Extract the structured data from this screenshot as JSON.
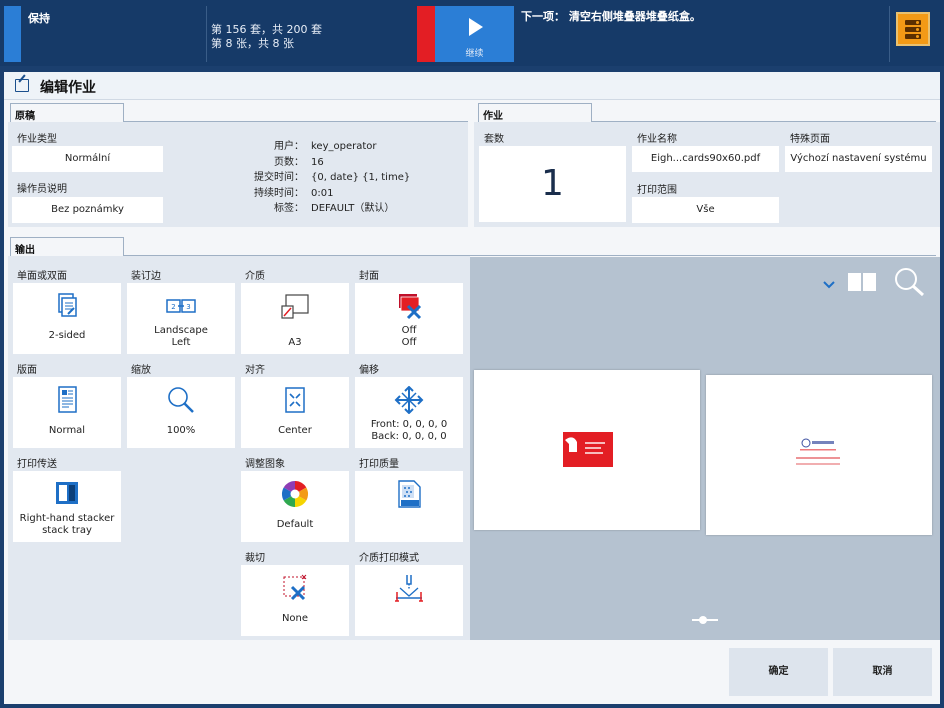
{
  "topbar": {
    "hold_label": "保持",
    "status_sets": "第 156 套，共 200 套",
    "status_sheets": "第 8 张，共 8 张",
    "continue_label": "继续",
    "next_step": "下一项： 清空右侧堆叠器堆叠纸盒。",
    "icons": {
      "continue": "play-icon",
      "menu": "stacker-menu-icon"
    }
  },
  "header": {
    "title": "编辑作业",
    "icon": "edit-job-icon"
  },
  "original": {
    "tab": "原稿",
    "job_type_label": "作业类型",
    "job_type_value": "Normální",
    "operator_note_label": "操作员说明",
    "operator_note_value": "Bez poznámky",
    "meta": [
      {
        "key": "用户：",
        "value": "key_operator"
      },
      {
        "key": "页数：",
        "value": "16"
      },
      {
        "key": "提交时间：",
        "value": "{0, date} {1, time}"
      },
      {
        "key": "持续时间：",
        "value": "0:01"
      },
      {
        "key": "标签：",
        "value": "DEFAULT（默认）"
      }
    ]
  },
  "job": {
    "tab": "作业",
    "copies_label": "套数",
    "copies_value": "1",
    "job_name_label": "作业名称",
    "job_name_value": "Eigh...cards90x60.pdf",
    "special_pages_label": "特殊页面",
    "special_pages_value": "Výchozí nastavení systému",
    "print_range_label": "打印范围",
    "print_range_value": "Vše"
  },
  "output": {
    "tab": "输出",
    "tiles": {
      "sides": {
        "label": "单面或双面",
        "value": "2-sided",
        "icon": "duplex-icon"
      },
      "binding": {
        "label": "装订边",
        "value": "Landscape",
        "value2": "Left",
        "icon": "binding-edge-icon"
      },
      "media": {
        "label": "介质",
        "value": "A3",
        "icon": "media-icon"
      },
      "cover": {
        "label": "封面",
        "value": "Off",
        "value2": "Off",
        "icon": "cover-off-icon"
      },
      "layout": {
        "label": "版面",
        "value": "Normal",
        "icon": "layout-icon"
      },
      "zoom": {
        "label": "缩放",
        "value": "100%",
        "icon": "zoom-icon"
      },
      "alignment": {
        "label": "对齐",
        "value": "Center",
        "icon": "align-center-icon"
      },
      "shift": {
        "label": "偏移",
        "value": "Front: 0, 0, 0, 0",
        "value2": "Back: 0, 0, 0, 0",
        "icon": "shift-icon"
      },
      "delivery": {
        "label": "打印传送",
        "value": "Right-hand stacker",
        "value2": "stack tray",
        "icon": "stacker-icon"
      },
      "image": {
        "label": "调整图象",
        "value": "Default",
        "icon": "color-wheel-icon"
      },
      "quality": {
        "label": "打印质量",
        "value": "",
        "icon": "print-quality-icon"
      },
      "trim": {
        "label": "裁切",
        "value": "None",
        "icon": "trim-off-icon"
      },
      "media_print_mode": {
        "label": "介质打印模式",
        "value": "",
        "icon": "media-print-mode-icon"
      }
    }
  },
  "preview": {
    "icons": [
      "chevron-down-icon",
      "book-view-icon",
      "magnifier-icon",
      "slider-icon"
    ]
  },
  "footer": {
    "ok": "确定",
    "cancel": "取消"
  },
  "colors": {
    "topbar": "#163a68",
    "accent": "#2b7ed6",
    "alert": "#e31e24",
    "menu": "#f39a16",
    "icon_blue": "#1e6fc6"
  }
}
